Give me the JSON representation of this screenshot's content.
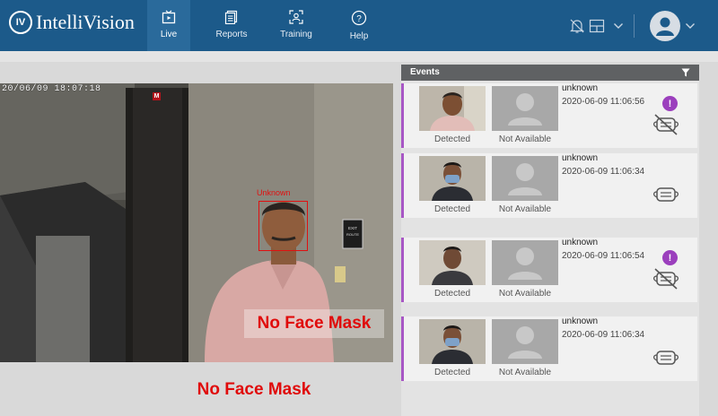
{
  "app": {
    "logo_badge": "IV",
    "name": "IntelliVision"
  },
  "nav": [
    {
      "label": "Live",
      "icon": "live-icon",
      "active": true
    },
    {
      "label": "Reports",
      "icon": "reports-icon"
    },
    {
      "label": "Training",
      "icon": "training-icon"
    },
    {
      "label": "Help",
      "icon": "help-icon"
    }
  ],
  "video": {
    "timestamp": "20/06/09  18:07:18",
    "logo_mark": "M",
    "face_label": "Unknown",
    "overlay_label": "No Face Mask"
  },
  "caption": "No Face Mask",
  "events": {
    "title": "Events",
    "items": [
      {
        "name": "unknown",
        "time": "2020-06-09 11:06:56",
        "photo_caption": "Detected",
        "placeholder_caption": "Not Available",
        "alert": "!",
        "mask": false
      },
      {
        "name": "unknown",
        "time": "2020-06-09 11:06:34",
        "photo_caption": "Detected",
        "placeholder_caption": "Not Available",
        "alert": "",
        "mask": true
      },
      {
        "name": "unknown",
        "time": "2020-06-09 11:06:54",
        "photo_caption": "Detected",
        "placeholder_caption": "Not Available",
        "alert": "!",
        "mask": false
      },
      {
        "name": "unknown",
        "time": "2020-06-09 11:06:34",
        "photo_caption": "Detected",
        "placeholder_caption": "Not Available",
        "alert": "",
        "mask": true
      }
    ]
  },
  "colors": {
    "topbar": "#1c5a8a",
    "accent": "#a857c5",
    "alert_red": "#e00b0b"
  }
}
